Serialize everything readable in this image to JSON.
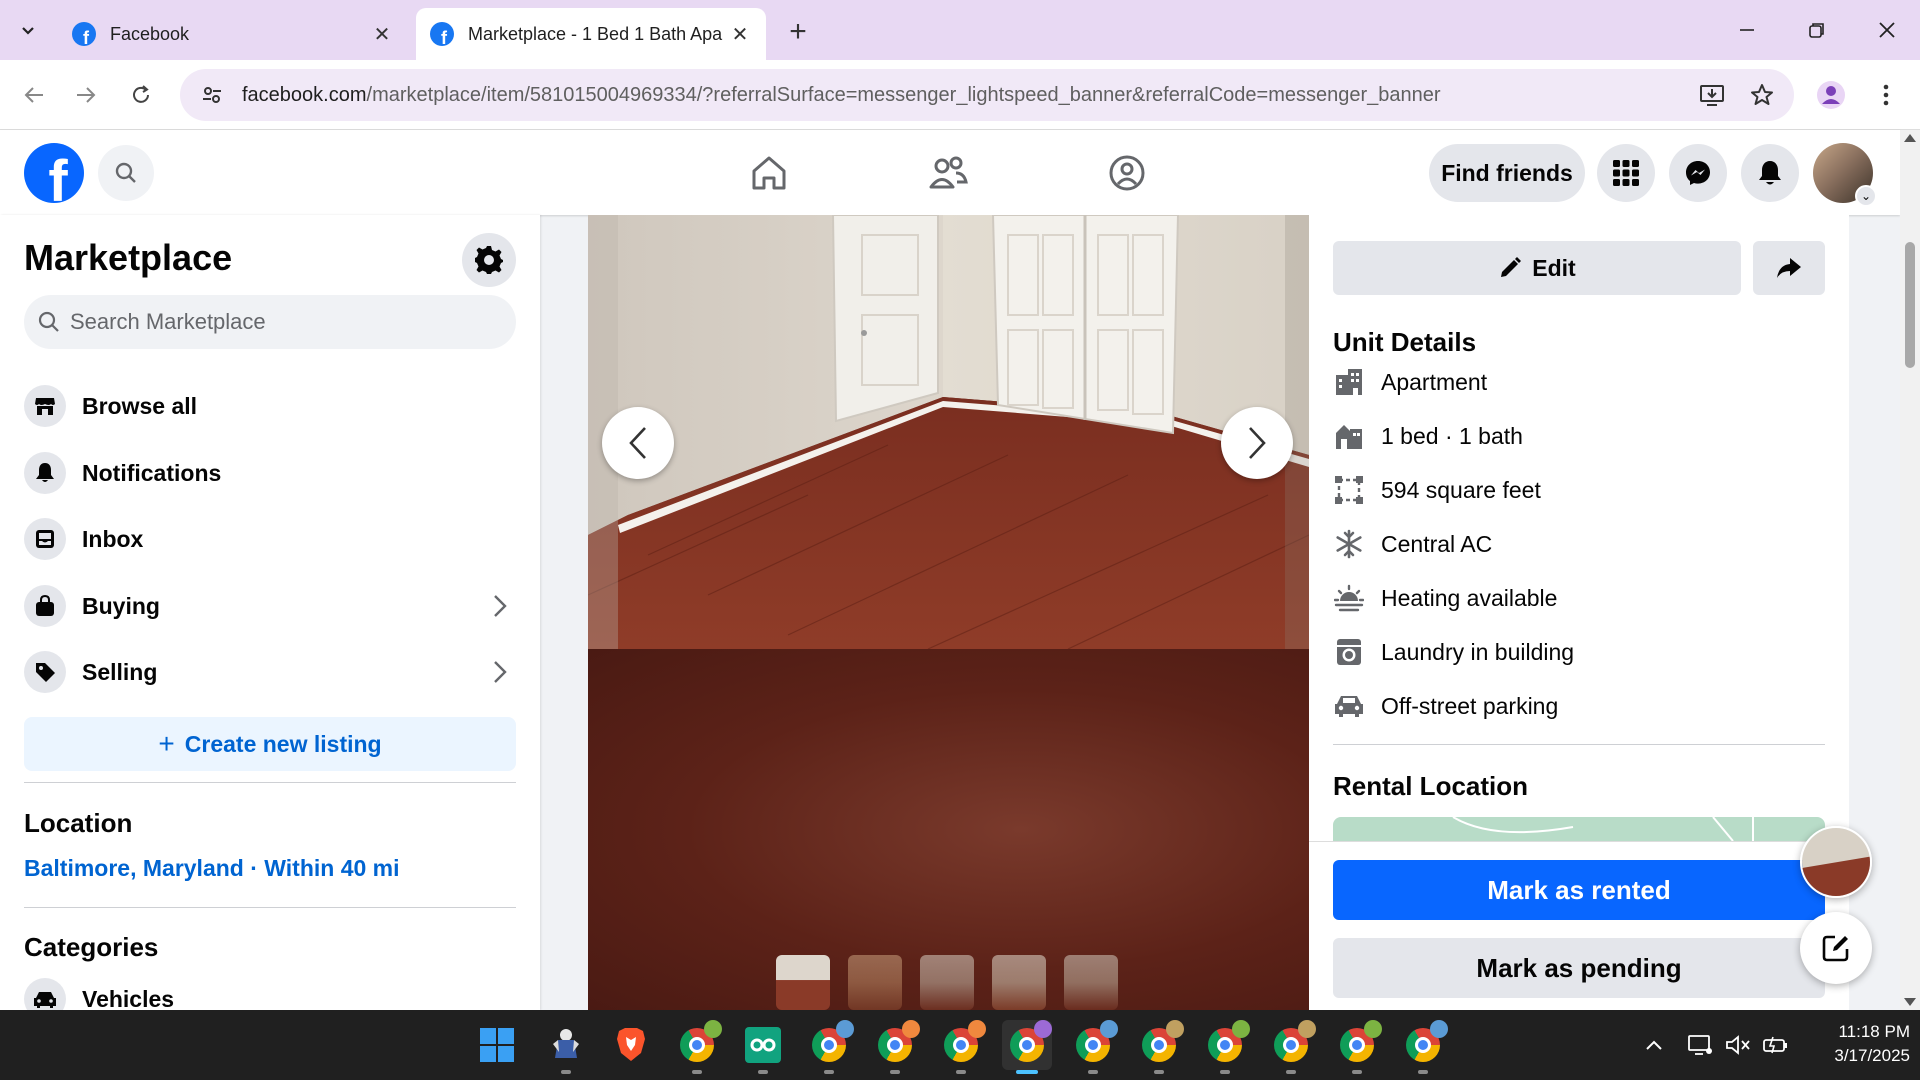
{
  "browser": {
    "tabs": [
      {
        "title": "Facebook",
        "active": false
      },
      {
        "title": "Marketplace - 1 Bed 1 Bath Apa",
        "active": true
      }
    ],
    "url_host": "facebook.com",
    "url_path": "/marketplace/item/581015004969334/?referralSurface=messenger_lightspeed_banner&referralCode=messenger_banner"
  },
  "fb_header": {
    "find_friends_label": "Find friends"
  },
  "sidebar": {
    "title": "Marketplace",
    "search_placeholder": "Search Marketplace",
    "items": [
      {
        "label": "Browse all",
        "icon": "storefront-icon"
      },
      {
        "label": "Notifications",
        "icon": "bell-icon"
      },
      {
        "label": "Inbox",
        "icon": "inbox-icon"
      },
      {
        "label": "Buying",
        "icon": "bag-icon",
        "has_arrow": true
      },
      {
        "label": "Selling",
        "icon": "tag-icon",
        "has_arrow": true
      }
    ],
    "create_listing_label": "Create new listing",
    "location_heading": "Location",
    "location_value": "Baltimore, Maryland · Within 40 mi",
    "categories_heading": "Categories",
    "first_category": "Vehicles"
  },
  "photo": {
    "thumbnail_count": 5,
    "active_thumbnail": 1
  },
  "details": {
    "edit_label": "Edit",
    "unit_details_heading": "Unit Details",
    "unit_details": [
      {
        "icon": "building-icon",
        "text": "Apartment"
      },
      {
        "icon": "house-icon",
        "text": "1 bed · 1 bath"
      },
      {
        "icon": "area-icon",
        "text": "594 square feet"
      },
      {
        "icon": "snowflake-icon",
        "text": "Central AC"
      },
      {
        "icon": "heat-icon",
        "text": "Heating available"
      },
      {
        "icon": "washer-icon",
        "text": "Laundry in building"
      },
      {
        "icon": "car-icon",
        "text": "Off-street parking"
      }
    ],
    "rental_location_heading": "Rental Location",
    "mark_rented_label": "Mark as rented",
    "mark_pending_label": "Mark as pending"
  },
  "taskbar": {
    "time": "11:18 PM",
    "date": "3/17/2025"
  },
  "colors": {
    "fb_blue": "#0866ff",
    "link_blue": "#0064d1",
    "tabstrip": "#e8d9f3"
  }
}
